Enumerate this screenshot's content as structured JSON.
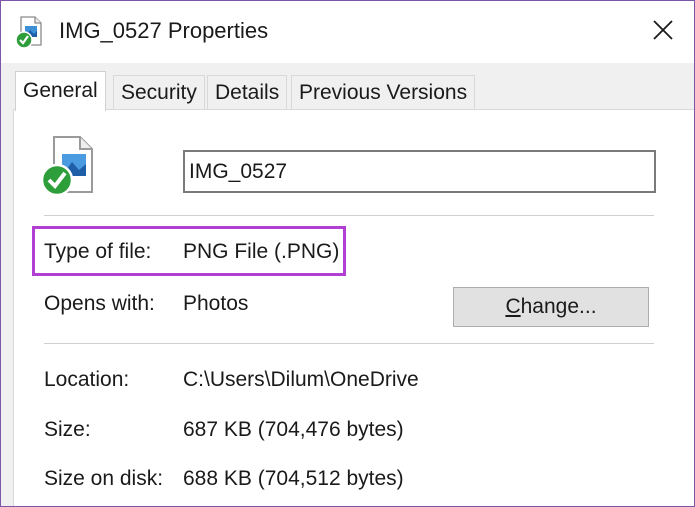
{
  "window": {
    "title": "IMG_0527 Properties",
    "close_glyph": "✕"
  },
  "tabs": [
    {
      "label": "General",
      "active": true
    },
    {
      "label": "Security",
      "active": false
    },
    {
      "label": "Details",
      "active": false
    },
    {
      "label": "Previous Versions",
      "active": false
    }
  ],
  "general": {
    "file_name": "IMG_0527",
    "type_label": "Type of file:",
    "type_value": "PNG File (.PNG)",
    "opens_label": "Opens with:",
    "opens_value": "Photos",
    "change_button": {
      "mnemonic": "C",
      "rest": "hange..."
    },
    "location_label": "Location:",
    "location_value": "C:\\Users\\Dilum\\OneDrive",
    "size_label": "Size:",
    "size_value": "687 KB (704,476 bytes)",
    "size_on_disk_label": "Size on disk:",
    "size_on_disk_value": "688 KB (704,512 bytes)"
  },
  "icons": {
    "title": "png-file-sync-icon",
    "file": "png-file-sync-icon",
    "close": "close-icon"
  },
  "colors": {
    "highlight": "#b23fd3",
    "sync_green": "#2e9e3a",
    "window_border": "#7a57a8"
  }
}
